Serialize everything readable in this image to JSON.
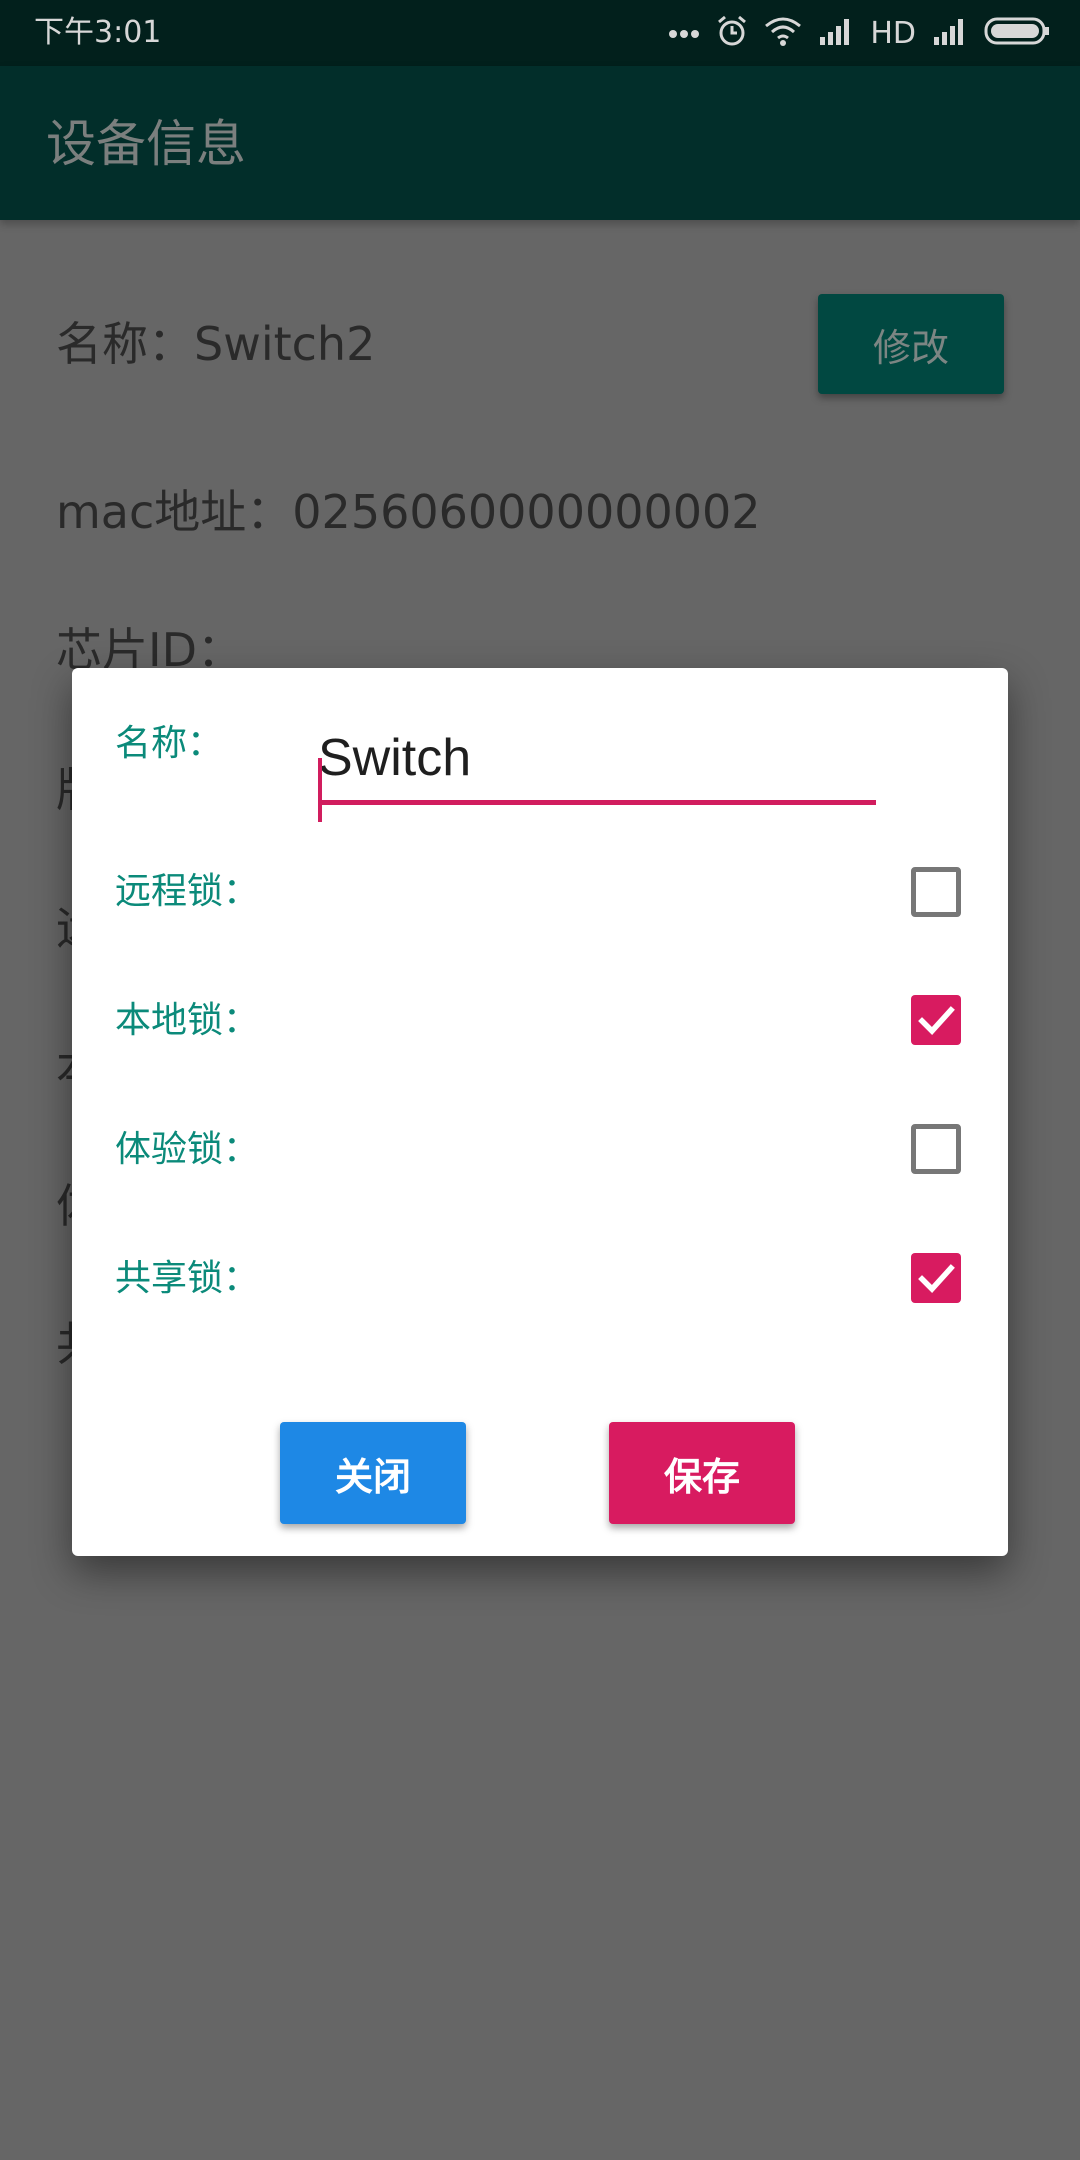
{
  "status_bar": {
    "time": "下午3:01",
    "network_label": "HD",
    "icons": [
      "more-dots-icon",
      "alarm-icon",
      "wifi-icon",
      "signal-icon",
      "signal-icon-2",
      "battery-icon"
    ]
  },
  "app_bar": {
    "title": "设备信息"
  },
  "device_info": {
    "name_line": "名称：Switch2",
    "edit_button": "修改",
    "mac_line": "mac地址：0256060000000002",
    "chip_line": "芯片ID：",
    "partial_lines": [
      "版",
      "远",
      "本",
      "体",
      "共"
    ]
  },
  "dialog": {
    "name_label": "名称：",
    "name_value": "Switch",
    "remote_lock_label": "远程锁：",
    "remote_lock_checked": false,
    "local_lock_label": "本地锁：",
    "local_lock_checked": true,
    "trial_lock_label": "体验锁：",
    "trial_lock_checked": false,
    "shared_lock_label": "共享锁：",
    "shared_lock_checked": true,
    "close_button": "关闭",
    "save_button": "保存"
  },
  "colors": {
    "accent": "#d81b60",
    "primary_dark": "#022e2a",
    "label_teal": "#0b8a7a",
    "close_blue": "#1e88e5"
  }
}
